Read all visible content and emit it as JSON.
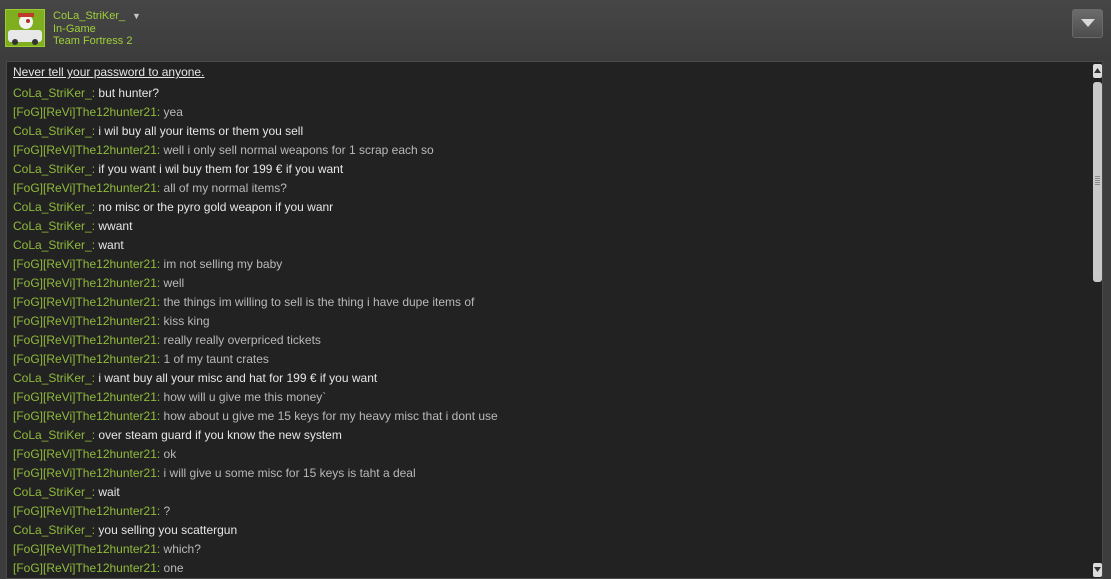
{
  "header": {
    "username": "CoLa_StriKer_",
    "status": "In-Game",
    "game": "Team Fortress 2"
  },
  "chat": {
    "warning": "Never tell your password to anyone.",
    "messages": [
      {
        "sender": "CoLa_StriKer_",
        "sep": ": ",
        "text": "but hunter?",
        "own": true
      },
      {
        "sender": "[FoG][ReVi]The12hunter21",
        "sep": ": ",
        "text": "yea",
        "own": false
      },
      {
        "sender": "CoLa_StriKer_",
        "sep": ": ",
        "text": "i wil buy all your items or them you sell",
        "own": true
      },
      {
        "sender": "[FoG][ReVi]The12hunter21",
        "sep": ": ",
        "text": "well i only sell normal weapons for 1 scrap each so",
        "own": false
      },
      {
        "sender": "CoLa_StriKer_",
        "sep": ": ",
        "text": "if you want i wil buy them for 199 € if you want",
        "own": true
      },
      {
        "sender": "[FoG][ReVi]The12hunter21",
        "sep": ": ",
        "text": "all of my normal items?",
        "own": false
      },
      {
        "sender": "CoLa_StriKer_",
        "sep": ": ",
        "text": "no misc or the pyro gold weapon if you wanr",
        "own": true
      },
      {
        "sender": "CoLa_StriKer_",
        "sep": ": ",
        "text": "wwant",
        "own": true
      },
      {
        "sender": "CoLa_StriKer_",
        "sep": ": ",
        "text": "want",
        "own": true
      },
      {
        "sender": "[FoG][ReVi]The12hunter21",
        "sep": ": ",
        "text": "im not selling my baby",
        "own": false
      },
      {
        "sender": "[FoG][ReVi]The12hunter21",
        "sep": ": ",
        "text": "well",
        "own": false
      },
      {
        "sender": "[FoG][ReVi]The12hunter21",
        "sep": ": ",
        "text": "the things im willing to sell is the thing i have dupe items of",
        "own": false
      },
      {
        "sender": "[FoG][ReVi]The12hunter21",
        "sep": ": ",
        "text": "kiss king",
        "own": false
      },
      {
        "sender": "[FoG][ReVi]The12hunter21",
        "sep": ": ",
        "text": "really really overpriced tickets",
        "own": false
      },
      {
        "sender": "[FoG][ReVi]The12hunter21",
        "sep": ": ",
        "text": "1 of my taunt crates",
        "own": false
      },
      {
        "sender": "CoLa_StriKer_",
        "sep": ": ",
        "text": "i want buy all your misc and hat for 199 € if you want",
        "own": true
      },
      {
        "sender": "[FoG][ReVi]The12hunter21",
        "sep": ": ",
        "text": "how will u give me this money`",
        "own": false
      },
      {
        "sender": "[FoG][ReVi]The12hunter21",
        "sep": ": ",
        "text": "how about u give me 15 keys for my heavy misc that i dont use",
        "own": false
      },
      {
        "sender": "CoLa_StriKer_",
        "sep": ": ",
        "text": "over steam guard if you know the new system",
        "own": true
      },
      {
        "sender": "[FoG][ReVi]The12hunter21",
        "sep": ": ",
        "text": "ok",
        "own": false
      },
      {
        "sender": "[FoG][ReVi]The12hunter21",
        "sep": ": ",
        "text": "i will give u some misc for 15 keys is taht a deal",
        "own": false
      },
      {
        "sender": "CoLa_StriKer_",
        "sep": ": ",
        "text": "wait",
        "own": true
      },
      {
        "sender": "[FoG][ReVi]The12hunter21",
        "sep": ": ",
        "text": "?",
        "own": false
      },
      {
        "sender": "CoLa_StriKer_",
        "sep": ": ",
        "text": "you selling you scattergun",
        "own": true
      },
      {
        "sender": "[FoG][ReVi]The12hunter21",
        "sep": ": ",
        "text": "which?",
        "own": false
      },
      {
        "sender": "[FoG][ReVi]The12hunter21",
        "sep": ": ",
        "text": "one",
        "own": false
      }
    ]
  },
  "icons": {
    "avatar": "avatar-icon",
    "dropdown": "chevron-down-icon",
    "menu": "menu-dropdown-icon",
    "scroll_up": "arrow-up-icon",
    "scroll_down": "arrow-down-icon"
  },
  "colors": {
    "accent_green": "#90ba3c",
    "own_text": "#e6e6e6",
    "other_text": "#b9b9b9",
    "chat_bg": "#222222"
  }
}
